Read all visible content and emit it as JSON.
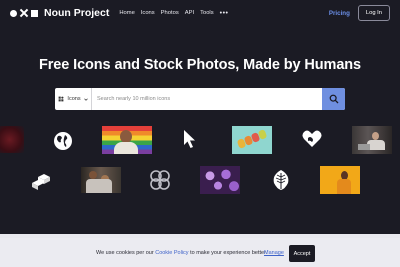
{
  "nav": {
    "brand": "Noun Project",
    "links": [
      "Home",
      "Icons",
      "Photos",
      "API",
      "Tools"
    ],
    "more_icon": "more-horizontal-icon",
    "pricing": "Pricing",
    "login": "Log In"
  },
  "hero": {
    "title": "Free Icons and Stock Photos, Made by Humans"
  },
  "search": {
    "type_selected": "Icons",
    "placeholder": "Search nearly 10 million icons"
  },
  "gallery": {
    "row1": [
      "dark-red-texture-photo",
      "globe-icon",
      "pride-flag-person-photo",
      "cursor-arrow-icon",
      "gummy-bears-photo",
      "heart-hands-icon",
      "person-laptop-photo"
    ],
    "row2": [
      "stairs-blocks-icon",
      "family-photo",
      "circles-pattern-icon",
      "purple-flowers-photo",
      "leaf-icon",
      "woman-yellow-photo"
    ]
  },
  "cookie": {
    "text_before": "We use cookies per our ",
    "link": "Cookie Policy",
    "text_after": " to make your experience better.",
    "manage": "Manage",
    "accept": "Accept"
  },
  "colors": {
    "background": "#1b1b24",
    "accent": "#6f8fe0",
    "pricing": "#6b8fe8"
  }
}
